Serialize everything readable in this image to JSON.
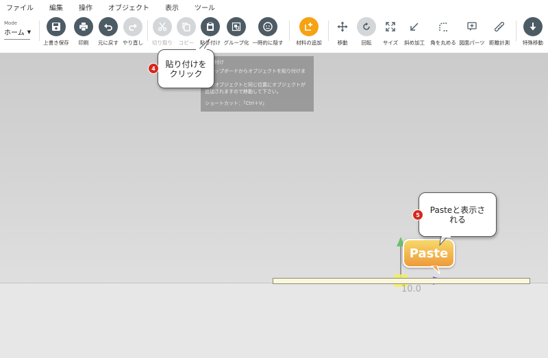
{
  "menu": [
    "ファイル",
    "編集",
    "操作",
    "オブジェクト",
    "表示",
    "ツール"
  ],
  "mode": {
    "caption": "Mode",
    "value": "ホーム"
  },
  "toolbar": {
    "overwrite_save": "上書き保存",
    "print": "印刷",
    "undo": "元に戻す",
    "redo": "やり直し",
    "cut": "切り取り",
    "copy": "コピー",
    "paste": "貼り付け",
    "group": "グループ化",
    "hide_temp": "一時的に隠す",
    "add_material": "材料の追加",
    "move": "移動",
    "rotate": "回転",
    "size": "サイズ",
    "bevel": "斜め加工",
    "round_corner": "角を丸める",
    "drawing_parts": "図面パーツ",
    "measure": "距離計測",
    "special_export": "特殊移動"
  },
  "tooltip": {
    "title": "貼り付け",
    "line1": "クリップボードからオブジェクトを貼り付けます。",
    "line2": "元のオブジェクトと同じ位置にオブジェクトが",
    "line3": "追加されますので移動して下さい。",
    "shortcut": "ショートカット：「Ctrl＋V」"
  },
  "callouts": {
    "step4": {
      "num": "4",
      "line1": "貼り付けを",
      "line2": "クリック"
    },
    "step5": {
      "num": "5",
      "line1": "Pasteと表示さ",
      "line2": "れる"
    }
  },
  "canvas": {
    "paste_label": "Paste",
    "dimension": "10.0"
  },
  "colors": {
    "toolbar_icon": "#4d5b65",
    "accent": "#f5a312",
    "badge": "#d7281e"
  }
}
